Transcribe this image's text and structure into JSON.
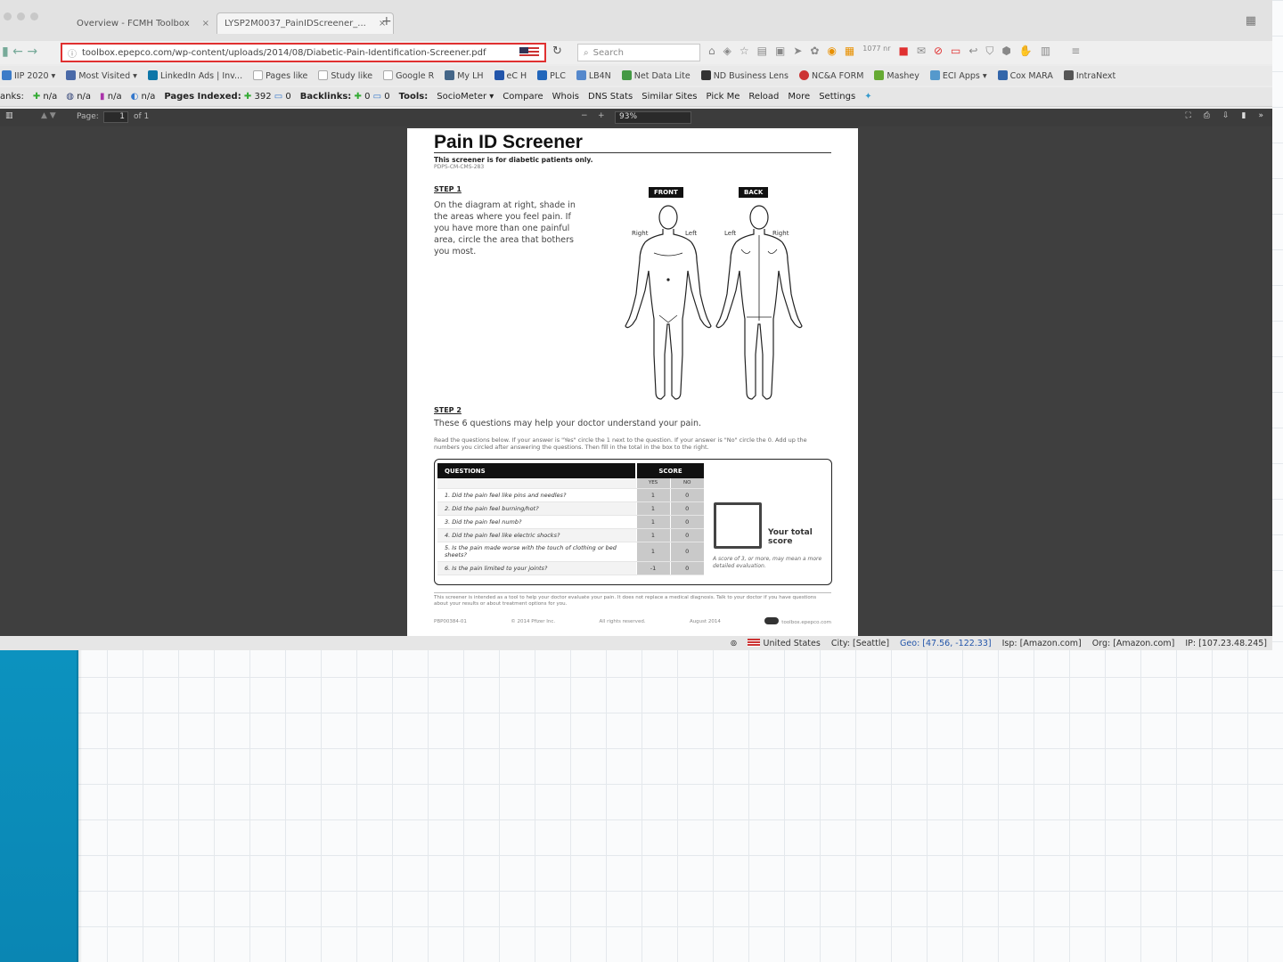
{
  "tabs": [
    {
      "title": "Overview - FCMH Toolbox",
      "close": "×"
    },
    {
      "title": "LYSP2M0037_PainIDScreener_...",
      "close": "×"
    }
  ],
  "new_tab": "+",
  "nav": {
    "url": "toolbox.epepco.com/wp-content/uploads/2014/08/Diabetic-Pain-Identification-Screener.pdf",
    "search_placeholder": "Search",
    "badge_count": "1077 nr"
  },
  "bookmarks": [
    {
      "label": "IIP 2020 ▾",
      "color": "#3b7bc8"
    },
    {
      "label": "Most Visited ▾",
      "color": "#4a6aa8"
    },
    {
      "label": "LinkedIn Ads | Inv...",
      "color": "#0e76a8"
    },
    {
      "label": "Pages like",
      "color": "#aaaaaa"
    },
    {
      "label": "Study like",
      "color": "#aaaaaa"
    },
    {
      "label": "Google R",
      "color": "#aaaaaa"
    },
    {
      "label": "My LH",
      "color": "#446688"
    },
    {
      "label": "eC H",
      "color": "#2255aa"
    },
    {
      "label": "PLC",
      "color": "#2266bb"
    },
    {
      "label": "LB4N",
      "color": "#5588cc"
    },
    {
      "label": "Net Data Lite",
      "color": "#449944"
    },
    {
      "label": "ND Business Lens",
      "color": "#333333"
    },
    {
      "label": "NC&A FORM",
      "color": "#cc3333"
    },
    {
      "label": "Mashey",
      "color": "#66aa33"
    },
    {
      "label": "ECI Apps ▾",
      "color": "#5599cc"
    },
    {
      "label": "Cox MARA",
      "color": "#3366aa"
    },
    {
      "label": "IntraNext",
      "color": "#555555"
    }
  ],
  "seo_bar": {
    "links_label": "anks:",
    "na1": "n/a",
    "na2": "n/a",
    "na3": "n/a",
    "na4": "n/a",
    "pages_indexed_label": "Pages Indexed:",
    "pages_indexed_value": "392",
    "pages_indexed_b": "0",
    "backlinks_label": "Backlinks:",
    "backlinks_value": "0",
    "backlinks_b": "0",
    "tools_label": "Tools:",
    "tools": [
      "SocioMeter ▾",
      "Compare",
      "Whois",
      "DNS Stats",
      "Similar Sites",
      "Pick Me",
      "Reload",
      "More",
      "Settings"
    ]
  },
  "pdf_toolbar": {
    "page_label": "Page:",
    "page_value": "1",
    "page_of": "of 1",
    "zoom_minus": "−",
    "zoom_plus": "+",
    "zoom_value": "93%"
  },
  "document": {
    "title": "Pain ID Screener",
    "subtitle": "This screener is for diabetic patients only.",
    "code": "PDPS-CM-CMS-283",
    "step1_label": "STEP 1",
    "step1_text": "On the diagram at right, shade in the areas where you feel pain. If you have more than one painful area, circle the area that bothers you most.",
    "front_label": "FRONT",
    "back_label": "BACK",
    "front_right": "Right",
    "front_left": "Left",
    "back_left": "Left",
    "back_right": "Right",
    "step2_label": "STEP 2",
    "step2_text": "These 6 questions may help your doctor understand your pain.",
    "step2_small": "Read the questions below. If your answer is \"Yes\" circle the 1 next to the question. If your answer is \"No\" circle the 0. Add up the numbers you circled after answering the questions. Then fill in the total in the box to the right.",
    "questions_header": "QUESTIONS",
    "score_header": "SCORE",
    "yes_label": "YES",
    "no_label": "NO",
    "questions": [
      {
        "text": "1. Did the pain feel like pins and needles?",
        "yes": "1",
        "no": "0"
      },
      {
        "text": "2. Did the pain feel burning/hot?",
        "yes": "1",
        "no": "0"
      },
      {
        "text": "3. Did the pain feel numb?",
        "yes": "1",
        "no": "0"
      },
      {
        "text": "4. Did the pain feel like electric shocks?",
        "yes": "1",
        "no": "0"
      },
      {
        "text": "5. Is the pain made worse with the touch of clothing or bed sheets?",
        "yes": "1",
        "no": "0"
      },
      {
        "text": "6. Is the pain limited to your joints?",
        "yes": "-1",
        "no": "0"
      }
    ],
    "total_label": "Your total score",
    "total_note": "A score of 3, or more, may mean a more detailed evaluation.",
    "footer_text": "This screener is intended as a tool to help your doctor evaluate your pain. It does not replace a medical diagnosis. Talk to your doctor if you have questions about your results or about treatment options for you.",
    "footer_items": [
      "PBP00384-01",
      "© 2014 Pfizer Inc.",
      "All rights reserved.",
      "August 2014"
    ],
    "footer_brand": "toolbox.epepco.com"
  },
  "statusbar": {
    "country": "United States",
    "city": "City: [Seattle]",
    "geo": "Geo: [47.56, -122.33]",
    "isp": "Isp: [Amazon.com]",
    "org": "Org: [Amazon.com]",
    "ip": "IP: [107.23.48.245]"
  },
  "colors": {
    "accent_bar": "#0d95c2",
    "url_highlight": "#e03030",
    "viewer_bg": "#3f3f3f"
  }
}
